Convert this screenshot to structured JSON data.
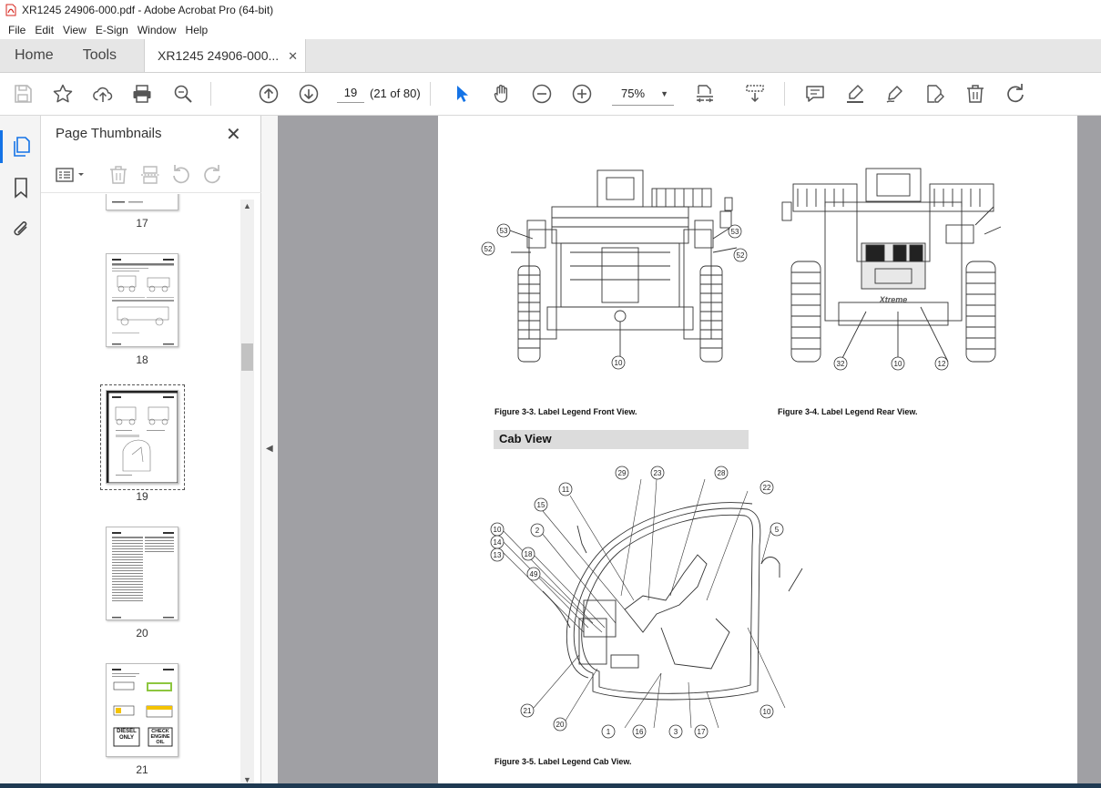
{
  "window": {
    "title": "XR1245 24906-000.pdf - Adobe Acrobat Pro (64-bit)"
  },
  "menubar": {
    "items": [
      "File",
      "Edit",
      "View",
      "E-Sign",
      "Window",
      "Help"
    ]
  },
  "tabs": {
    "home_label": "Home",
    "tools_label": "Tools",
    "document_label": "XR1245 24906-000...",
    "close_glyph": "✕"
  },
  "toolbar": {
    "page_number": "19",
    "page_count": "(21 of 80)",
    "zoom_level": "75%",
    "icons": [
      "save-icon",
      "star-icon",
      "upload-icon",
      "print-icon",
      "search-icon",
      "page-up-icon",
      "page-down-icon",
      "select-cursor-icon",
      "hand-icon",
      "zoom-out-icon",
      "zoom-in-icon",
      "fit-page-icon",
      "scroll-mode-icon",
      "comment-icon",
      "highlight-icon",
      "sign-icon",
      "edit-pdf-icon",
      "delete-icon",
      "redo-icon"
    ]
  },
  "thumbnail_panel": {
    "title": "Page Thumbnails",
    "close_glyph": "✕",
    "thumbnails": [
      {
        "label": "17"
      },
      {
        "label": "18"
      },
      {
        "label": "19",
        "selected": true
      },
      {
        "label": "20"
      },
      {
        "label": "21"
      }
    ],
    "thumb21_text": {
      "diesel": "DIESEL ONLY",
      "engine": "CHECK ENGINE OIL"
    }
  },
  "document": {
    "figure_front_caption": "Figure 3-3.  Label Legend Front View.",
    "figure_rear_caption": "Figure 3-4.  Label Legend Rear View.",
    "section_heading": "Cab View",
    "figure_cab_caption": "Figure 3-5.  Label Legend Cab View.",
    "rear_brand_text": "Xtreme",
    "front_callouts": [
      "53",
      "52",
      "53",
      "52",
      "10"
    ],
    "rear_callouts": [
      "32",
      "10",
      "12"
    ],
    "cab_callouts": [
      "29",
      "23",
      "28",
      "22",
      "11",
      "15",
      "10",
      "14",
      "13",
      "2",
      "18",
      "49",
      "5",
      "21",
      "20",
      "1",
      "16",
      "3",
      "17",
      "10"
    ]
  },
  "colors": {
    "accent": "#1473e6",
    "document_background": "#a0a0a4",
    "section_bar": "#dcdcdc"
  }
}
